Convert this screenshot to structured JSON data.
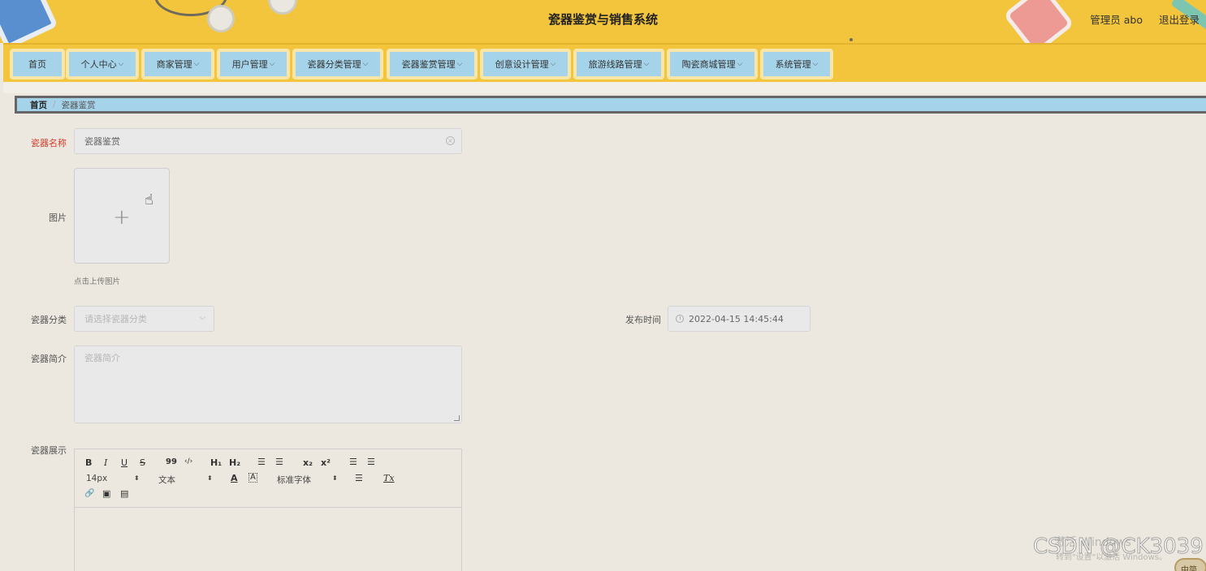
{
  "header": {
    "title": "瓷器鉴赏与销售系统",
    "user_label": "管理员 abo",
    "logout_label": "退出登录"
  },
  "nav": {
    "items": [
      {
        "label": "首页",
        "has_dropdown": false
      },
      {
        "label": "个人中心",
        "has_dropdown": true
      },
      {
        "label": "商家管理",
        "has_dropdown": true
      },
      {
        "label": "用户管理",
        "has_dropdown": true
      },
      {
        "label": "瓷器分类管理",
        "has_dropdown": true
      },
      {
        "label": "瓷器鉴赏管理",
        "has_dropdown": true
      },
      {
        "label": "创意设计管理",
        "has_dropdown": true
      },
      {
        "label": "旅游线路管理",
        "has_dropdown": true
      },
      {
        "label": "陶瓷商城管理",
        "has_dropdown": true
      },
      {
        "label": "系统管理",
        "has_dropdown": true
      }
    ],
    "chevron": "⌵"
  },
  "breadcrumb": {
    "home": "首页",
    "separator": "/",
    "current": "瓷器鉴赏"
  },
  "form": {
    "name": {
      "label": "瓷器名称",
      "value": "瓷器鉴赏"
    },
    "image": {
      "label": "图片",
      "plus": "+",
      "hint": "点击上传图片"
    },
    "category": {
      "label": "瓷器分类",
      "placeholder": "请选择瓷器分类"
    },
    "publish_time": {
      "label": "发布时间",
      "value": "2022-04-15 14:45:44"
    },
    "intro": {
      "label": "瓷器简介",
      "placeholder": "瓷器简介"
    },
    "display": {
      "label": "瓷器展示"
    }
  },
  "editor": {
    "bold": "B",
    "italic": "I",
    "underline": "U",
    "strike": "S",
    "quote": "99",
    "code": "‹/›",
    "h1": "H₁",
    "h2": "H₂",
    "ordered_list": "☰",
    "bullet_list": "☰",
    "subscript": "x₂",
    "superscript": "x²",
    "outdent": "☰",
    "indent": "☰",
    "font_size": "14px",
    "text_style": "文本",
    "font_color": "A",
    "bg_color": "A",
    "font_family": "标准字体",
    "align": "☰",
    "clear_format": "Tx",
    "link": "🔗",
    "image": "▣",
    "video": "▤",
    "select_arrows": "⬍"
  },
  "watermark": {
    "activate_windows": "激活 Windows",
    "activate_hint": "转到\"设置\"以激活 Windows。",
    "csdn": "CSDN @CK3039",
    "ime": "中简"
  }
}
